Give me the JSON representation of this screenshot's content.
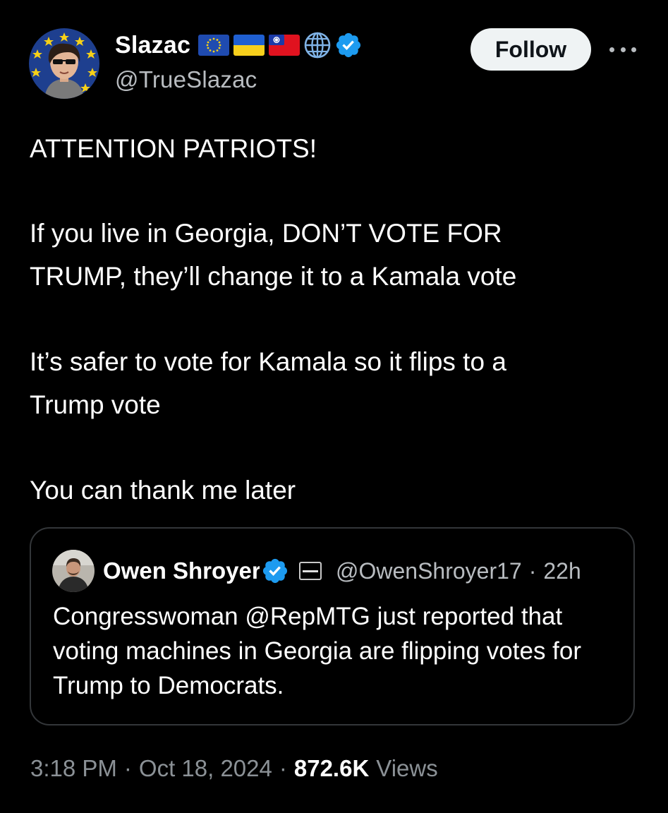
{
  "post": {
    "author": {
      "display_name": "Slazac",
      "handle": "@TrueSlazac",
      "badges": [
        "eu-flag-icon",
        "ukraine-flag-icon",
        "taiwan-flag-icon",
        "globe-icon",
        "verified-badge-icon"
      ],
      "verified": true
    },
    "follow_label": "Follow",
    "more_icon": "more-horizontal-icon",
    "paragraphs": [
      "ATTENTION PATRIOTS!",
      "If you live in Georgia, DON’T VOTE FOR\nTRUMP, they’ll change it to a Kamala vote",
      "It’s safer to vote for Kamala so it flips to a\nTrump vote",
      "You can thank me later"
    ],
    "quote": {
      "display_name": "Owen Shroyer",
      "verified": true,
      "affiliation_icon": "conservative-affiliation-icon",
      "handle": "@OwenShroyer17",
      "separator": "·",
      "time": "22h",
      "text": "Congresswoman @RepMTG just reported that voting machines in Georgia are flipping votes for Trump to Democrats."
    },
    "meta": {
      "time": "3:18 PM",
      "separator": "·",
      "date": "Oct 18, 2024",
      "views_count": "872.6K",
      "views_label": "Views"
    }
  },
  "colors": {
    "background": "#000000",
    "text_primary": "#ffffff",
    "text_secondary": "#8b9196",
    "verified_blue": "#1d9bf0",
    "border": "#333639",
    "follow_bg": "#eff3f4"
  }
}
